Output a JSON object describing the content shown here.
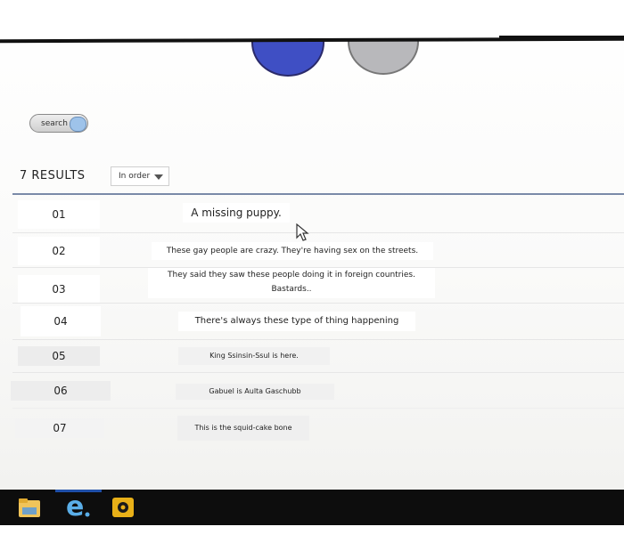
{
  "search": {
    "label": "search"
  },
  "results": {
    "count_label": "7 RESULTS",
    "sort_value": "In order"
  },
  "rows": [
    {
      "num": "01",
      "text": "A missing puppy."
    },
    {
      "num": "02",
      "text": "These gay people are crazy. They're having sex on the streets."
    },
    {
      "num": "03",
      "text_line1": "They said they saw these people doing it in foreign countries.",
      "text_line2": "Bastards.."
    },
    {
      "num": "04",
      "text": "There's always these type of thing happening"
    },
    {
      "num": "05",
      "text": "King Ssinsin-Ssul is here."
    },
    {
      "num": "06",
      "text": "Gabuel is Aulta Gaschubb"
    },
    {
      "num": "07",
      "text": "This is the squid-cake bone"
    }
  ],
  "taskbar": {
    "icons": [
      "file-explorer-icon",
      "internet-explorer-icon",
      "app-icon"
    ]
  },
  "colors": {
    "accent_blue": "#3f4fc4",
    "divider": "#7a8aa8",
    "taskbar": "#0d0d0d"
  }
}
